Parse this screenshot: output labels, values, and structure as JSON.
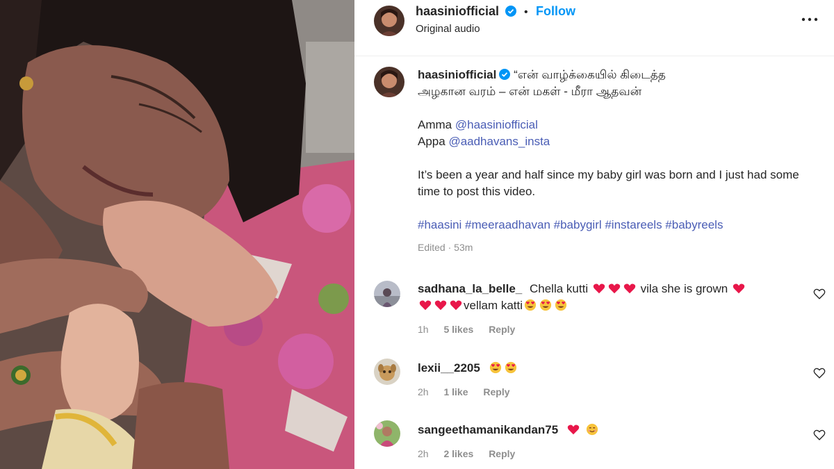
{
  "post": {
    "username": "haasiniofficial",
    "follow_label": "Follow",
    "audio": "Original audio",
    "caption": {
      "username": "haasiniofficial",
      "line1": "“என் வாழ்க்கையில் கிடைத்த",
      "line2": "அழகான வரம் – என் மகள் - மீரா ஆதவன்",
      "amma_label": "Amma",
      "amma_handle": "@haasiniofficial",
      "appa_label": "Appa",
      "appa_handle": "@aadhavans_insta",
      "body": "It’s been a year and half since my baby girl was born and I just had some time to post this video.",
      "hashtags": "#haasini #meeraadhavan #babygirl #instareels #babyreels",
      "edited": "Edited",
      "time": "53m"
    }
  },
  "comments": [
    {
      "user": "sadhana_la_belle_",
      "text1": "Chella kutti",
      "text2": "vila she is grown",
      "text3": "vellam katti",
      "time": "1h",
      "likes": "5 likes",
      "reply": "Reply"
    },
    {
      "user": "lexii__2205",
      "time": "2h",
      "likes": "1 like",
      "reply": "Reply"
    },
    {
      "user": "sangeethamanikandan75",
      "time": "2h",
      "likes": "2 likes",
      "reply": "Reply"
    }
  ],
  "colors": {
    "accent": "#0095f6",
    "link": "#4a5db5",
    "heart": "#e8174a",
    "muted": "#8e8e8e"
  },
  "icons": [
    "verified-badge-icon",
    "more-options-icon",
    "like-heart-icon",
    "red-heart-emoji",
    "heart-eyes-emoji",
    "smiling-emoji"
  ]
}
